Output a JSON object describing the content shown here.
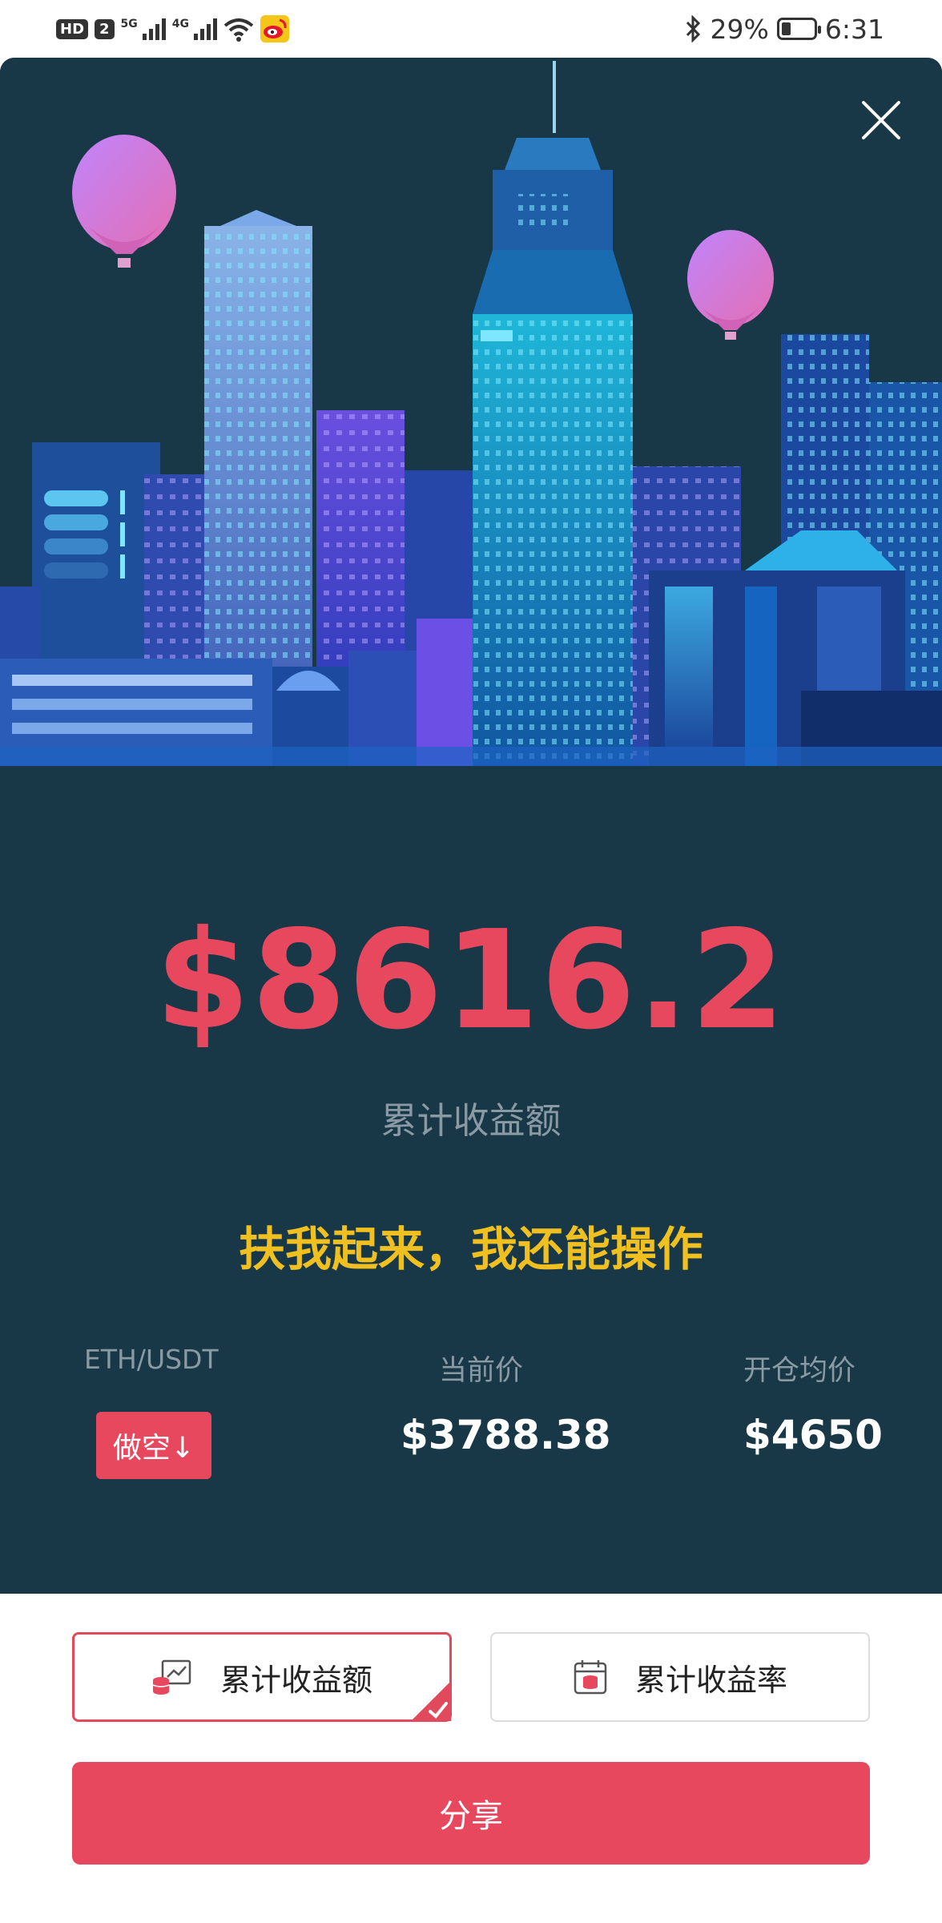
{
  "status_bar": {
    "hd": "HD",
    "sim": "2",
    "sig1": "5G",
    "sig2": "4G",
    "battery_percent": "29%",
    "battery_level": 0.29,
    "time": "6:31"
  },
  "card": {
    "amount": "$8616.2",
    "amount_label": "累计收益额",
    "slogan": "扶我起来，我还能操作",
    "pair": "ETH/USDT",
    "direction": "做空↓",
    "current_price_label": "当前价",
    "current_price": "$3788.38",
    "avg_price_label": "开仓均价",
    "avg_price": "$4650"
  },
  "options": [
    {
      "label": "累计收益额",
      "icon": "income-chart-icon",
      "selected": true
    },
    {
      "label": "累计收益率",
      "icon": "calendar-icon",
      "selected": false
    }
  ],
  "share_label": "分享",
  "colors": {
    "card_bg": "#183847",
    "accent_red": "#e8485e",
    "slogan_yellow": "#f0c020"
  }
}
